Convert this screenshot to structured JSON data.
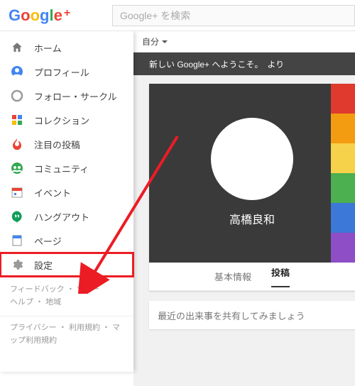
{
  "logo": {
    "text": "Google",
    "plus": "+"
  },
  "search": {
    "placeholder": "Google+ を検索"
  },
  "owner_dropdown": "自分",
  "sidebar": {
    "items": [
      {
        "label": "ホーム",
        "icon": "home-icon"
      },
      {
        "label": "プロフィール",
        "icon": "profile-icon"
      },
      {
        "label": "フォロー・サークル",
        "icon": "circles-icon"
      },
      {
        "label": "コレクション",
        "icon": "collections-icon"
      },
      {
        "label": "注目の投稿",
        "icon": "whats-hot-icon"
      },
      {
        "label": "コミュニティ",
        "icon": "communities-icon"
      },
      {
        "label": "イベント",
        "icon": "events-icon"
      },
      {
        "label": "ハングアウト",
        "icon": "hangouts-icon"
      },
      {
        "label": "ページ",
        "icon": "pages-icon"
      },
      {
        "label": "設定",
        "icon": "settings-icon"
      }
    ],
    "footer1": "フィードバック ・ ツアー\nヘルプ ・ 地域",
    "footer2": "プライバシー ・ 利用規約 ・ マップ利用規約"
  },
  "welcome": "新しい Google+ へようこそ。　より",
  "profile": {
    "name": "高橋良和",
    "tabs": {
      "about": "基本情報",
      "posts": "投稿"
    }
  },
  "share_placeholder": "最近の出来事を共有してみましょう",
  "colors": {
    "highlight": "#ec1c24"
  }
}
